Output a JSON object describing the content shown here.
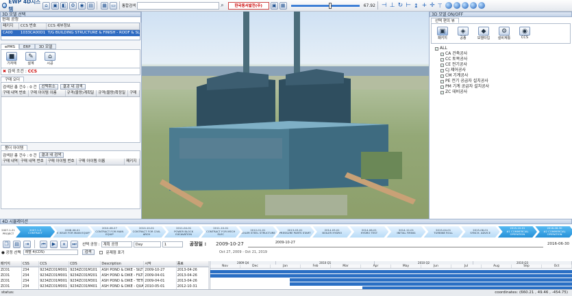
{
  "app": {
    "title": "EWP 4D시스템"
  },
  "toolbar": {
    "search_label": "통합검색",
    "kepco_label": "한국동서발전(주)",
    "zoom_value": "67.92"
  },
  "left_panel": {
    "title": "3D 모델 선택",
    "current_process_label": "현재 공정",
    "header_cols": [
      "패키지",
      "CCS 번호",
      "CCS 세부정보"
    ],
    "selected_row": [
      "CA00",
      "1033CA00D1",
      "T/G BUILDING STRUCTURE & FINISH - ROOF & SLAB"
    ],
    "tabs": [
      "ePMS",
      "ERP",
      "3D 모델"
    ],
    "buttons": [
      "기자재",
      "설계",
      "시공"
    ],
    "search_cond_label": "검색 조건 :",
    "search_cond_value": "CCS",
    "purchase_order_section": "구매 오더",
    "result_count_label": "검색된 총 건수 : 0 건",
    "clear_btn": "선택취소",
    "search_in_result_btn": "결과 내 검색",
    "po_cols": [
      "구매 내역 번호",
      "구매 아이템 이름",
      "규격(물량)계획일",
      "규격(물량)확정일",
      "구매"
    ],
    "purchase_item_section": "품더 아이템",
    "result_count_label2": "검색된 총 건수 : 0 건",
    "search_in_result_btn2": "결과 내 검색",
    "item_cols": [
      "구매 내역",
      "구매 내역 번호",
      "구매 아이템 번호",
      "구매 아이템 이름",
      "패키지"
    ]
  },
  "right_panel": {
    "title": "3D 모델 ON/OFF",
    "tab": "선택 편의 뷰",
    "buttons": [
      "패키지",
      "공종",
      "모델타입",
      "설비계통",
      "CCS"
    ],
    "tree": [
      "ALL",
      "CA 건축공사",
      "CC 토목공사",
      "CE 전기공사",
      "CJ 제어공사",
      "CM 기계공사",
      "PE 전기 공급자 설치공사",
      "PM 기계 공급자 설치공사",
      "ZC 데비공사"
    ]
  },
  "simulation": {
    "title": "4D 시뮬레이션",
    "start_top": "2007-1-21",
    "start_label": "PROJECT",
    "end_date": "2016-06-30",
    "milestones": [
      {
        "date": "2007-1-2",
        "label": "CONTRACT",
        "blue": true
      },
      {
        "date": "2008-06-01",
        "label": "PE ISSUE FOR MAIN EQUIP",
        "blue": false
      },
      {
        "date": "2010-08-27",
        "label": "CONTRACT FOR MAIN EQUIP",
        "blue": false
      },
      {
        "date": "2010-10-01",
        "label": "CONTRACT FOR CIVIL ARCH",
        "blue": false
      },
      {
        "date": "2011-04-01",
        "label": "POWER BLOCK EXCAVATION",
        "blue": false
      },
      {
        "date": "2011-10-01",
        "label": "CONTRACT FOR MECH ELEC",
        "blue": false
      },
      {
        "date": "2012-01-01",
        "label": "BOILER STEEL STRUCTURE",
        "blue": false
      },
      {
        "date": "2013-03-01",
        "label": "PRESSURE PARTS START",
        "blue": false
      },
      {
        "date": "2014-03-01",
        "label": "BOILER HYDRO",
        "blue": false
      },
      {
        "date": "2014-06-01",
        "label": "HYDRO TEST",
        "blue": false
      },
      {
        "date": "2014-12-01",
        "label": "INITIAL FIRING",
        "blue": false
      },
      {
        "date": "2015-04-01",
        "label": "TURBINE ROLL",
        "blue": false
      },
      {
        "date": "2015-06-01",
        "label": "SYNCH. ADVICE",
        "blue": false
      },
      {
        "date": "2015-10-01",
        "label": "#1 COMMERCIAL OPERATION",
        "blue": true
      },
      {
        "date": "2016-06-30",
        "label": "#2 COMMERCIAL OPERATION",
        "blue": true
      }
    ],
    "controls": {
      "select_label": "선택 공정 :",
      "select_value": "계획 공정",
      "unit_value": "Day",
      "step_value": "1"
    },
    "process_date_label": "공정일 :",
    "process_date_value": "2009-10-27",
    "tick_date": "2009-10-27",
    "filter_label": "공정 선택",
    "filter_value": "레벨 4(CDS)",
    "search_btn": "검색",
    "problem_check_label": "문제점 표기",
    "date_range": "Oct 27, 2009 - Oct 21, 2019",
    "gantt_years": [
      "2009 Q4",
      "2010 Q1",
      "2010 Q2",
      "2010 Q3"
    ],
    "gantt_months": [
      "Nov",
      "Dec",
      "Jan",
      "Feb",
      "Mar",
      "Apr",
      "May",
      "Jun",
      "Jul",
      "Aug",
      "Sep",
      "Oct"
    ],
    "table_cols": [
      "패키지",
      "CSS",
      "CCS",
      "CDS",
      "Description",
      "시작",
      "종료"
    ],
    "rows": [
      [
        "ZC01",
        "234",
        "9234ZC01M001",
        "9234ZC01M101",
        "ASH POND & DIKE - SILT PROTEC",
        "2009-10-27",
        "2013-04-26"
      ],
      [
        "ZC01",
        "234",
        "9234ZC01M001",
        "9234ZC01M201",
        "ASH POND & DIKE - FILTERMAT &",
        "2009-04-01",
        "2013-04-26"
      ],
      [
        "ZC01",
        "234",
        "9234ZC01M001",
        "9234ZC01M301",
        "ASH POND & DIKE - TETRA.PORT",
        "2009-04-01",
        "2013-04-26"
      ],
      [
        "ZC01",
        "234",
        "9234ZC01M001",
        "9234ZC01M401",
        "ASH POND & DIKE - QUARRY RUN",
        "2010-05-01",
        "2012-10-31"
      ]
    ],
    "gantt_bars": [
      {
        "start": 0.0,
        "end": 1.0
      },
      {
        "start": 0.0,
        "end": 1.0
      },
      {
        "start": 0.22,
        "end": 1.0
      },
      {
        "start": 0.22,
        "end": 1.0
      },
      {
        "start": 0.42,
        "end": 1.0
      }
    ]
  },
  "status": {
    "label": "status:",
    "coordinates": "coordinates: (660.21 , 49.46 , -454.75)"
  }
}
